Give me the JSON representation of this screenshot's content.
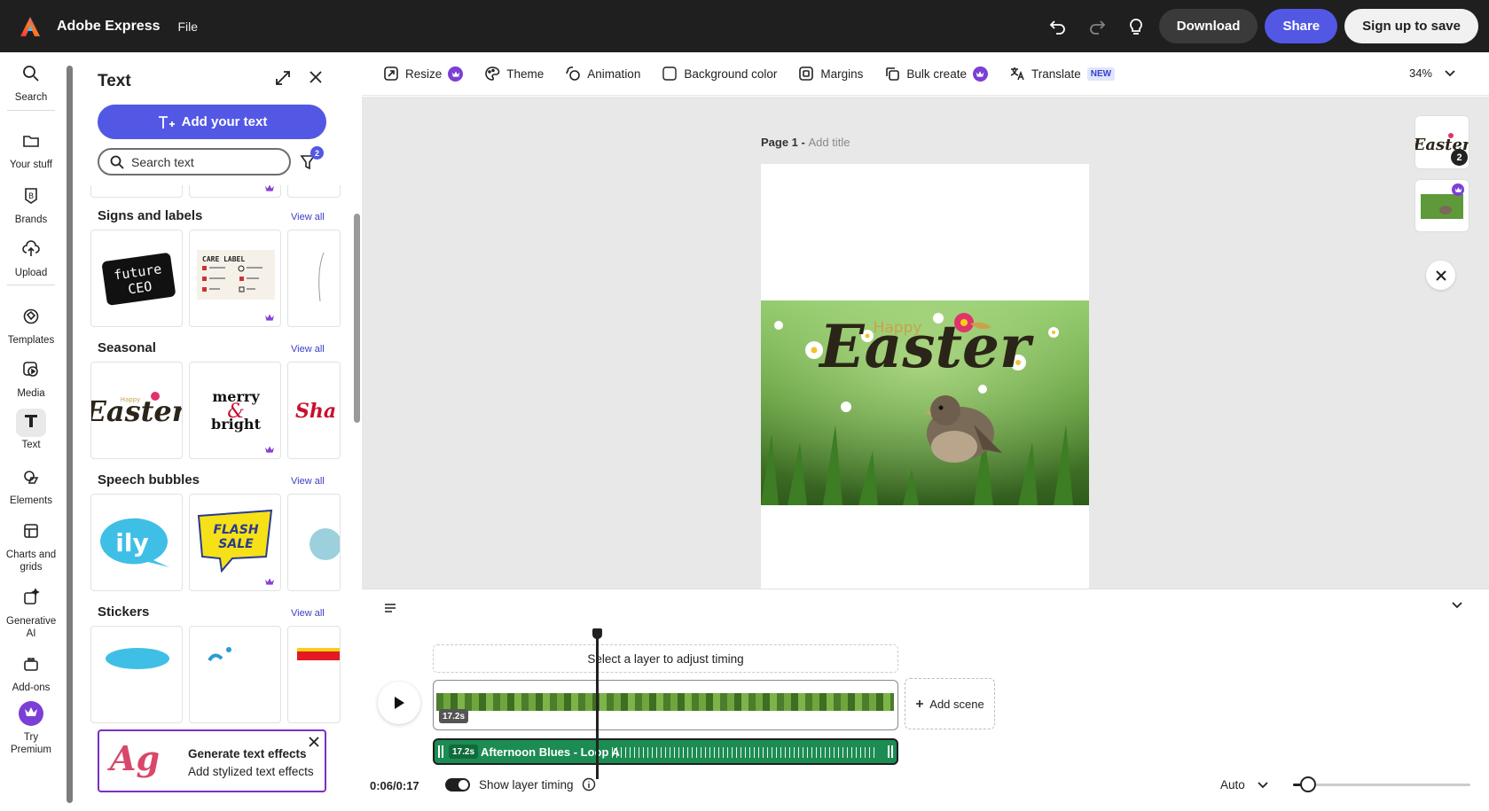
{
  "app": {
    "title": "Adobe Express",
    "file_menu": "File"
  },
  "header_actions": {
    "download": "Download",
    "share": "Share",
    "signup": "Sign up to save"
  },
  "rail": {
    "items": [
      {
        "label": "Search"
      },
      {
        "label": "Your stuff"
      },
      {
        "label": "Brands"
      },
      {
        "label": "Upload"
      },
      {
        "label": "Templates"
      },
      {
        "label": "Media"
      },
      {
        "label": "Text"
      },
      {
        "label": "Elements"
      },
      {
        "label": "Charts and grids"
      },
      {
        "label": "Generative AI"
      },
      {
        "label": "Add-ons"
      },
      {
        "label": "Try Premium"
      }
    ],
    "active": "Text"
  },
  "panel": {
    "title": "Text",
    "add_text_label": "Add your text",
    "search_placeholder": "Search text",
    "filter_count": "2",
    "sections": [
      {
        "title": "Signs and labels",
        "view_all": "View all",
        "cards": [
          "future CEO",
          "CARE LABEL"
        ]
      },
      {
        "title": "Seasonal",
        "view_all": "View all",
        "cards": [
          "Easter",
          "merry & bright",
          "Sha"
        ]
      },
      {
        "title": "Speech bubbles",
        "view_all": "View all",
        "cards": [
          "ily",
          "FLASH SALE"
        ]
      },
      {
        "title": "Stickers",
        "view_all": "View all",
        "cards": []
      }
    ],
    "seasonal_card_small": "Happy",
    "gen_card": {
      "title": "Generate text effects",
      "subtitle": "Add stylized text effects",
      "art": "Ag"
    }
  },
  "toolbar": {
    "resize": "Resize",
    "theme": "Theme",
    "animation": "Animation",
    "background_color": "Background color",
    "margins": "Margins",
    "bulk_create": "Bulk create",
    "translate": "Translate",
    "new_badge": "NEW",
    "zoom": "34%"
  },
  "canvas": {
    "page_label": "Page 1 - ",
    "add_title": "Add title",
    "design_small": "Happy",
    "design_big": "Easter",
    "page_count": "2",
    "thumb_text": "Easter"
  },
  "timeline": {
    "layer_hint": "Select a layer to adjust timing",
    "video_duration": "17.2s",
    "audio_duration": "17.2s",
    "audio_title": "Afternoon Blues - Loop A",
    "add_scene": "Add scene",
    "time": "0:06/0:17",
    "show_layer_timing": "Show layer timing",
    "auto": "Auto",
    "playhead_fraction": 0.353,
    "zoom_slider_fraction": 0.05
  },
  "colors": {
    "accent": "#5258e4",
    "premium": "#7b3fd6",
    "topbar": "#1f1f1f",
    "audio": "#1c8c52"
  }
}
